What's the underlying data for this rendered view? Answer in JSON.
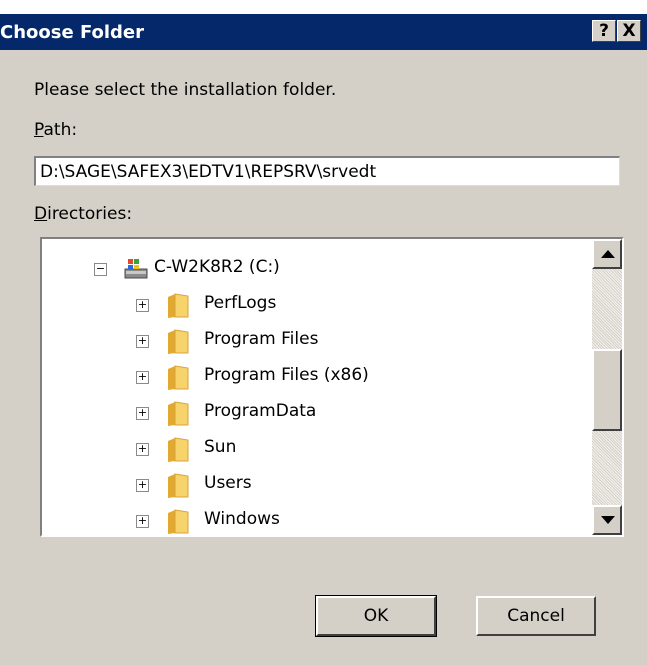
{
  "window": {
    "title": "Choose Folder",
    "help_label": "?",
    "close_label": "X"
  },
  "dialog": {
    "prompt": "Please select the installation folder.",
    "path_label_accel": "P",
    "path_label_rest": "ath:",
    "path_value": "D:\\SAGE\\SAFEX3\\EDTV1\\REPSRV\\srvedt",
    "directories_label_accel": "D",
    "directories_label_rest": "irectories:"
  },
  "tree": {
    "root": {
      "label": "C-W2K8R2 (C:)",
      "expander": "−",
      "icon": "drive-icon"
    },
    "children": [
      {
        "label": "PerfLogs",
        "expander": "+",
        "icon": "folder-icon"
      },
      {
        "label": "Program Files",
        "expander": "+",
        "icon": "folder-icon"
      },
      {
        "label": "Program Files (x86)",
        "expander": "+",
        "icon": "folder-icon"
      },
      {
        "label": "ProgramData",
        "expander": "+",
        "icon": "folder-icon"
      },
      {
        "label": "Sun",
        "expander": "+",
        "icon": "folder-icon"
      },
      {
        "label": "Users",
        "expander": "+",
        "icon": "folder-icon"
      },
      {
        "label": "Windows",
        "expander": "+",
        "icon": "folder-icon"
      }
    ]
  },
  "buttons": {
    "ok": "OK",
    "cancel": "Cancel"
  },
  "colors": {
    "titlebar": "#05286b",
    "dialog_bg": "#d4d0c8",
    "folder": "#f2c14e"
  }
}
